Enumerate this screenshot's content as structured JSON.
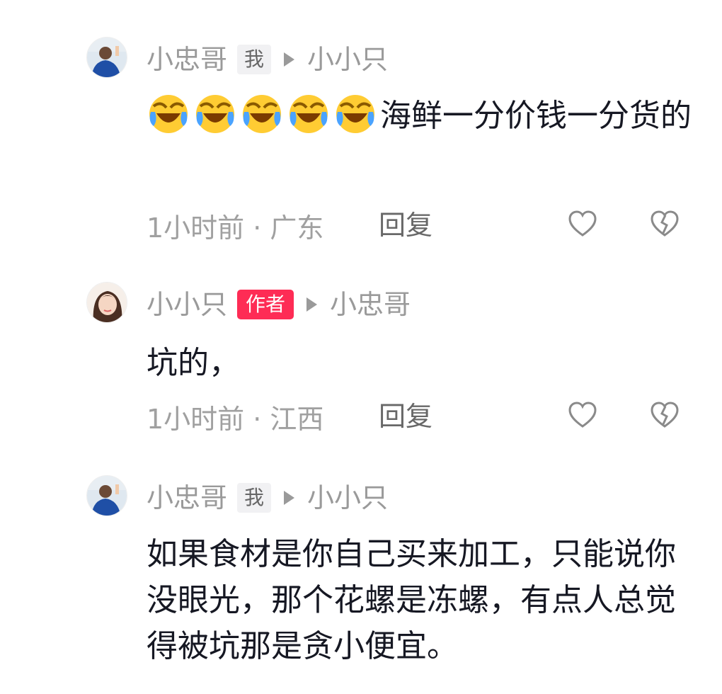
{
  "comments": [
    {
      "username": "小忠哥",
      "badge": "我",
      "reply_to": "小小只",
      "emoji_count": 5,
      "emoji_name": "laughing-crying-emoji",
      "text": "海鲜一分价钱一分货的",
      "time": "1小时前 · 广东",
      "reply_label": "回复"
    },
    {
      "username": "小小只",
      "badge": "作者",
      "reply_to": "小忠哥",
      "text": "坑的，",
      "time": "1小时前 · 江西",
      "reply_label": "回复"
    },
    {
      "username": "小忠哥",
      "badge": "我",
      "reply_to": "小小只",
      "text": "如果食材是你自己买来加工，只能说你没眼光，那个花螺是冻螺，有点人总觉得被坑那是贪小便宜。"
    }
  ],
  "icons": {
    "like": "heart-outline-icon",
    "dislike": "broken-heart-icon",
    "reply_arrow": "play-triangle-icon"
  },
  "colors": {
    "author_badge": "#fe2c55",
    "muted_text": "#9a9a9a",
    "body_text": "#161823"
  }
}
